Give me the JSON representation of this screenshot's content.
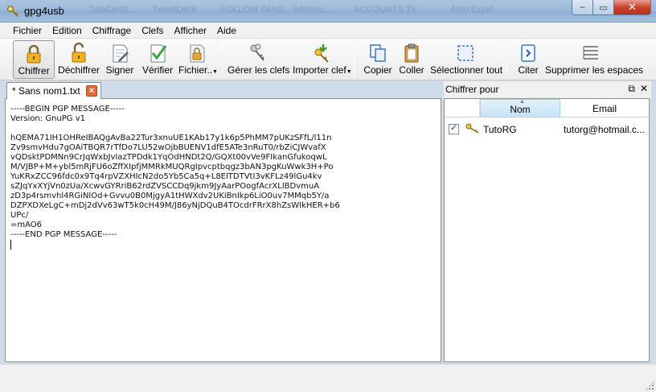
{
  "window": {
    "title": "gpg4usb",
    "background_ghost_tabs": [
      "TutoCertif...",
      "TweetDeck",
      "FOLLOW FANS",
      "inferiou...",
      "ACCOUNTS TV",
      "Auto Excel"
    ],
    "controls": {
      "minimize": "–",
      "maximize": "▭",
      "close": "✕"
    }
  },
  "menu": [
    "Fichier",
    "Edition",
    "Chiffrage",
    "Clefs",
    "Afficher",
    "Aide"
  ],
  "toolbar": {
    "encrypt": "Chiffrer",
    "decrypt": "Déchiffrer",
    "sign": "Signer",
    "verify": "Vérifier",
    "file": "Fichier..",
    "manage_keys": "Gérer les clefs",
    "import_key": "Importer clef",
    "copy": "Copier",
    "paste": "Coller",
    "select_all": "Sélectionner tout",
    "quote": "Citer",
    "remove_spaces": "Supprimer les espaces"
  },
  "editor": {
    "tab_title": "* Sans nom1.txt",
    "content": "-----BEGIN PGP MESSAGE-----\nVersion: GnuPG v1\n\nhQEMA71IH1OHReIBAQgAvBa22Tur3xnuUE1KAb17y1k6p5PhMM7pUKzSFfL/l11n\nZv9smvHdu7gOAiTBQR7rTfDo7LU52wOjbBUENV1dfE5ATe3nRuT0/rbZiCJWvafX\nvQDsktPDMNn9CrJqWxbJvIazTPDdk1YqOdHNDt2Q/GQXt00vVe9FIkanGfukoqwL\nM/VJBP+M+ybl5mRjFU6oZffXIpfjMMRkMUQRgIpvcptbqgz3bAN3pgKuWwk3H+Po\nYuKRxZCC96fdc0x9Tq4rpVZXHIcN2do5Yb5Ca5q+L8ElTDTVtI3vKFLz49lGu4kv\nsZJqYxXYjVn0zUa/XcwvGYRriB62rdZVSCCDq9jkm9JyAarPOogfAcrXLlBDvmuA\nzD3p4rsmvhl4RGiNlOd+Gvvu0B0MjgyA1tHWXdv2UKiBnIkp6LiO0uv7MMqb5Y/a\nDZPXDXeLgC+mDj2dVv63wT5k0cH49M/J86yNjDQuB4TOcdrFRrX8hZsWIkHER+b6\nUPc/\n=mAO6\n-----END PGP MESSAGE-----"
  },
  "encrypt_for": {
    "title": "Chiffrer pour",
    "columns": {
      "name": "Nom",
      "email": "Email"
    },
    "rows": [
      {
        "checked": true,
        "name": "TutoRG",
        "email": "tutorg@hotmail.c..."
      }
    ]
  }
}
